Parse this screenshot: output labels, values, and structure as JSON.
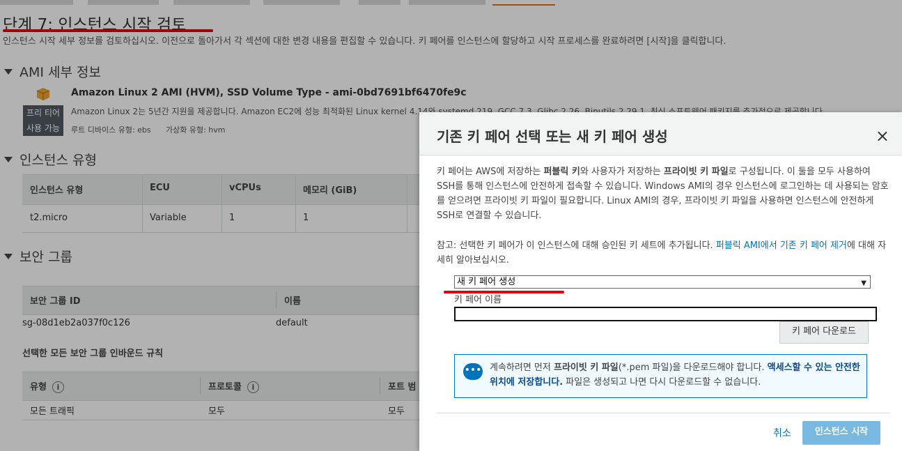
{
  "page": {
    "title": "단계 7: 인스턴스 시작 검토",
    "description": "인스턴스 시작 세부 정보를 검토하십시오. 이전으로 돌아가서 각 섹션에 대한 변경 내용을 편집할 수 있습니다. 키 페어를 인스턴스에 할당하고 시작 프로세스를 완료하려면 [시작]을 클릭합니다."
  },
  "ami": {
    "section_title": "AMI 세부 정보",
    "name": "Amazon Linux 2 AMI (HVM), SSD Volume Type - ami-0bd7691bf6470fe9c",
    "description": "Amazon Linux 2는 5년간 지원을 제공합니다. Amazon EC2에 성능 최적화된 Linux kernel 4.14와 systemd 219, GCC 7.3, Glibc 2.26, Binutils 2.29.1, 최신 소프트웨어 패키지를 추가적으로 제공합니다.",
    "free_tier_line1": "프리 티어",
    "free_tier_line2": "사용 가능",
    "root_device": "루트 디바이스 유형: ebs",
    "virtualization": "가상화 유형: hvm"
  },
  "instance_type": {
    "section_title": "인스턴스 유형",
    "headers": [
      "인스턴스 유형",
      "ECU",
      "vCPUs",
      "메모리 (GiB)"
    ],
    "row": [
      "t2.micro",
      "Variable",
      "1",
      "1"
    ]
  },
  "security": {
    "section_title": "보안 그룹",
    "headers": [
      "보안 그룹 ID",
      "이름"
    ],
    "row": [
      "sg-08d1eb2a037f0c126",
      "default"
    ],
    "rules_title": "선택한 모든 보안 그룹 인바운드 규칙",
    "rule_headers": [
      "유형",
      "프로토콜",
      "포트 범"
    ],
    "rule_row": [
      "모든 트래픽",
      "모두",
      "모두"
    ]
  },
  "modal": {
    "title": "기존 키 페어 선택 또는 새 키 페어 생성",
    "close": "×",
    "para1_a": "키 페어는 AWS에 저장하는 ",
    "para1_b": "퍼블릭 키",
    "para1_c": "와 사용자가 저장하는 ",
    "para1_d": "프라이빗 키 파일",
    "para1_e": "로 구성됩니다. 이 둘을 모두 사용하여 SSH를 통해 인스턴스에 안전하게 접속할 수 있습니다. Windows AMI의 경우 인스턴스에 로그인하는 데 사용되는 암호를 얻으려면 프라이빗 키 파일이 필요합니다. Linux AMI의 경우, 프라이빗 키 파일을 사용하면 인스턴스에 안전하게 SSH로 연결할 수 있습니다.",
    "para2_a": "참고: 선택한 키 페어가 이 인스턴스에 대해 승인된 키 세트에 추가됩니다. ",
    "para2_link": "퍼블릭 AMI에서 기존 키 페어 제거",
    "para2_b": "에 대해 자세히 알아보십시오.",
    "select_value": "새 키 페어 생성",
    "key_name_label": "키 페어 이름",
    "key_name_value": "",
    "download_button": "키 페어 다운로드",
    "notice_a": "계속하려면 먼저 ",
    "notice_b": "프라이빗 키 파일",
    "notice_c": "(*.pem 파일)을 다운로드해야 합니다. ",
    "notice_d": "액세스할 수 있는 안전한 위치에 저장합니다.",
    "notice_e": " 파일은 생성되고 나면 다시 다운로드할 수 없습니다.",
    "cancel": "취소",
    "launch": "인스턴스 시작"
  },
  "colors": {
    "annotation_red": "#e3000f",
    "link_blue": "#0073bb",
    "launch_button": "#79b8e0"
  }
}
